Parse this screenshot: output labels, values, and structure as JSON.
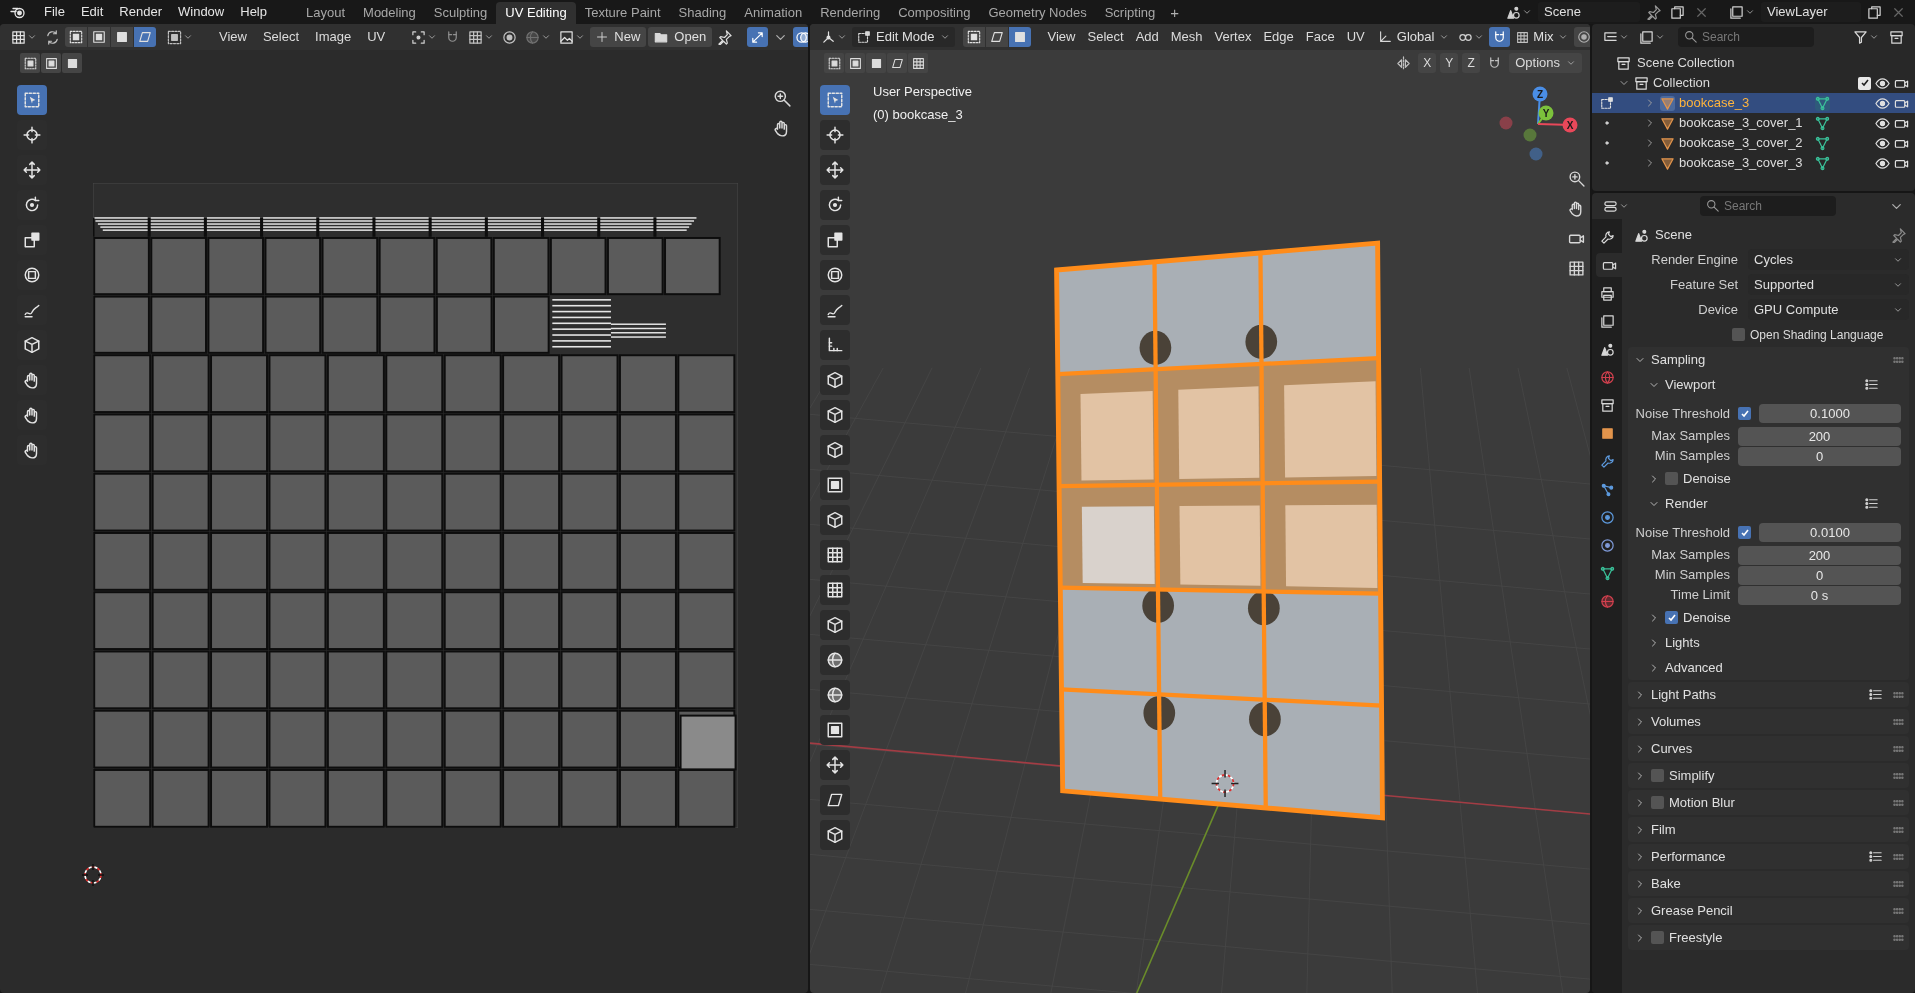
{
  "top_bar": {
    "menus": [
      "File",
      "Edit",
      "Render",
      "Window",
      "Help"
    ],
    "workspaces": [
      {
        "label": "Layout",
        "selected": false
      },
      {
        "label": "Modeling",
        "selected": false
      },
      {
        "label": "Sculpting",
        "selected": false
      },
      {
        "label": "UV Editing",
        "selected": true
      },
      {
        "label": "Texture Paint",
        "selected": false
      },
      {
        "label": "Shading",
        "selected": false
      },
      {
        "label": "Animation",
        "selected": false
      },
      {
        "label": "Rendering",
        "selected": false
      },
      {
        "label": "Compositing",
        "selected": false
      },
      {
        "label": "Geometry Nodes",
        "selected": false
      },
      {
        "label": "Scripting",
        "selected": false
      }
    ],
    "add_workspace": "+",
    "scene": "Scene",
    "view_layer": "ViewLayer"
  },
  "uv_editor": {
    "select_modes": [
      {
        "selected": false
      },
      {
        "selected": false
      },
      {
        "selected": false
      },
      {
        "selected": true
      }
    ],
    "menus": [
      "View",
      "Select",
      "Image",
      "UV"
    ],
    "new_button": "New",
    "open_button": "Open",
    "tools": [
      {
        "kind": "select",
        "selected": true
      },
      {
        "kind": "cursor",
        "selected": false
      },
      {
        "kind": "move",
        "selected": false
      },
      {
        "kind": "rotate",
        "selected": false
      },
      {
        "kind": "scale",
        "selected": false
      },
      {
        "kind": "transform",
        "selected": false
      },
      {
        "kind": "annotate",
        "selected": false
      },
      {
        "kind": "cube",
        "selected": false
      },
      {
        "kind": "hand",
        "selected": false
      },
      {
        "kind": "hand",
        "selected": false
      },
      {
        "kind": "hand",
        "selected": false
      }
    ]
  },
  "viewport": {
    "mode": "Edit Mode",
    "select_modes": [
      {
        "selected": false
      },
      {
        "selected": false
      },
      {
        "selected": true
      }
    ],
    "menus": [
      "View",
      "Select",
      "Add",
      "Mesh",
      "Vertex",
      "Edge",
      "Face",
      "UV"
    ],
    "orientation": "Global",
    "snap_target": "Mix",
    "mirror_axes": [
      "X",
      "Y",
      "Z"
    ],
    "options": "Options",
    "view_name": "User Perspective",
    "object_label": "(0) bookcase_3",
    "gizmo": [
      {
        "kind": "z",
        "label": "Z",
        "color": "#4a8ee6"
      },
      {
        "kind": "y",
        "label": "Y",
        "color": "#7cc23c"
      },
      {
        "kind": "x",
        "label": "X",
        "color": "#e9485a"
      }
    ],
    "tools": [
      {
        "kind": "select",
        "selected": true
      },
      {
        "kind": "cursor",
        "selected": false
      },
      {
        "kind": "move",
        "selected": false
      },
      {
        "kind": "rotate",
        "selected": false
      },
      {
        "kind": "scale",
        "selected": false
      },
      {
        "kind": "transform",
        "selected": false
      },
      {
        "kind": "annotate",
        "selected": false
      },
      {
        "kind": "measure",
        "selected": false
      },
      {
        "kind": "cube",
        "selected": false
      },
      {
        "kind": "cube",
        "selected": false
      },
      {
        "kind": "cube",
        "selected": false
      },
      {
        "kind": "inset",
        "selected": false
      },
      {
        "kind": "cube",
        "selected": false
      },
      {
        "kind": "grid",
        "selected": false
      },
      {
        "kind": "grid",
        "selected": false
      },
      {
        "kind": "cube",
        "selected": false
      },
      {
        "kind": "sphere",
        "selected": false
      },
      {
        "kind": "sphere",
        "selected": false
      },
      {
        "kind": "inset",
        "selected": false
      },
      {
        "kind": "move",
        "selected": false
      },
      {
        "kind": "shear",
        "selected": false
      },
      {
        "kind": "cube",
        "selected": false
      }
    ]
  },
  "outliner": {
    "search_placeholder": "Search",
    "scene_collection": "Scene Collection",
    "collection": {
      "name": "Collection",
      "expanded": true,
      "checked": true
    },
    "objects": [
      {
        "name": "bookcase_3",
        "selected": true
      },
      {
        "name": "bookcase_3_cover_1",
        "selected": false
      },
      {
        "name": "bookcase_3_cover_2",
        "selected": false
      },
      {
        "name": "bookcase_3_cover_3",
        "selected": false
      }
    ]
  },
  "properties": {
    "search_placeholder": "Search",
    "context": "Scene",
    "tabs": [
      {
        "kind": "tool",
        "selected": false
      },
      {
        "kind": "render",
        "selected": true
      },
      {
        "kind": "output",
        "selected": false
      },
      {
        "kind": "view_layer",
        "selected": false
      },
      {
        "kind": "scene",
        "selected": false
      },
      {
        "kind": "world",
        "selected": false
      },
      {
        "kind": "collection",
        "selected": false
      },
      {
        "kind": "object",
        "selected": false
      },
      {
        "kind": "modifiers",
        "selected": false
      },
      {
        "kind": "particles",
        "selected": false
      },
      {
        "kind": "physics",
        "selected": false
      },
      {
        "kind": "constraints",
        "selected": false
      },
      {
        "kind": "data",
        "selected": false
      },
      {
        "kind": "material",
        "selected": false
      }
    ],
    "fields": [
      {
        "label": "Render Engine",
        "value": "Cycles"
      },
      {
        "label": "Feature Set",
        "value": "Supported"
      },
      {
        "label": "Device",
        "value": "GPU Compute"
      }
    ],
    "osl": {
      "label": "Open Shading Language",
      "checked": false
    },
    "rows": [
      {
        "kind": "panel",
        "label": "Sampling",
        "expanded": true
      },
      {
        "kind": "subpanel",
        "label": "Viewport",
        "expanded": true,
        "presets": true
      },
      {
        "kind": "toggle_value",
        "label": "Noise Threshold",
        "checked": true,
        "value": "0.1000"
      },
      {
        "kind": "value",
        "label": "Max Samples",
        "value": "200"
      },
      {
        "kind": "value",
        "label": "Min Samples",
        "value": "0"
      },
      {
        "kind": "subpanel",
        "label": "Denoise",
        "expanded": false,
        "checked": false
      },
      {
        "kind": "subpanel",
        "label": "Render",
        "expanded": true,
        "presets": true
      },
      {
        "kind": "toggle_value",
        "label": "Noise Threshold",
        "checked": true,
        "value": "0.0100"
      },
      {
        "kind": "value",
        "label": "Max Samples",
        "value": "200"
      },
      {
        "kind": "value",
        "label": "Min Samples",
        "value": "0"
      },
      {
        "kind": "value",
        "label": "Time Limit",
        "value": "0 s"
      },
      {
        "kind": "subpanel",
        "label": "Denoise",
        "expanded": false,
        "checked": true
      },
      {
        "kind": "subpanel",
        "label": "Lights",
        "expanded": false
      },
      {
        "kind": "subpanel",
        "label": "Advanced",
        "expanded": false
      },
      {
        "kind": "panel",
        "label": "Light Paths",
        "expanded": false,
        "presets": true
      },
      {
        "kind": "panel",
        "label": "Volumes",
        "expanded": false
      },
      {
        "kind": "panel",
        "label": "Curves",
        "expanded": false
      },
      {
        "kind": "panel",
        "label": "Simplify",
        "expanded": false,
        "checked": false
      },
      {
        "kind": "panel",
        "label": "Motion Blur",
        "expanded": false,
        "checked": false
      },
      {
        "kind": "panel",
        "label": "Film",
        "expanded": false
      },
      {
        "kind": "panel",
        "label": "Performance",
        "expanded": false,
        "presets": true
      },
      {
        "kind": "panel",
        "label": "Bake",
        "expanded": false
      },
      {
        "kind": "panel",
        "label": "Grease Pencil",
        "expanded": false
      },
      {
        "kind": "panel",
        "label": "Freestyle",
        "expanded": false,
        "checked": false
      }
    ]
  }
}
